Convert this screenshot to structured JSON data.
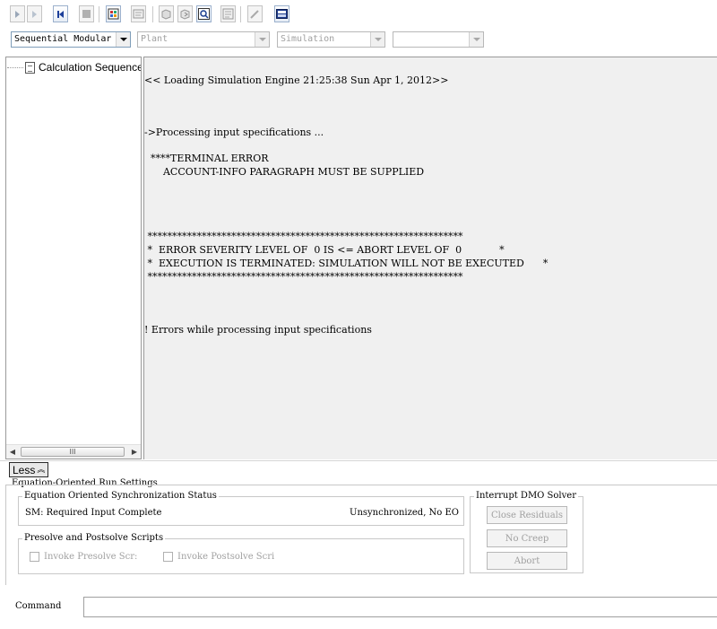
{
  "toolbar": {
    "buttons": [
      {
        "name": "next-button",
        "icon": "play-next-icon"
      },
      {
        "name": "run-button",
        "icon": "play-icon"
      },
      {
        "name": "reinitialize-button",
        "icon": "step-first-icon"
      },
      {
        "name": "stop-button",
        "icon": "stop-icon"
      },
      {
        "name": "control-panel-button",
        "icon": "control-panel-icon"
      },
      {
        "name": "results-button",
        "icon": "results-icon"
      },
      {
        "name": "check-status-button",
        "icon": "check-status-icon"
      },
      {
        "name": "export-button",
        "icon": "export-icon"
      },
      {
        "name": "view-report-button",
        "icon": "magnifier-icon"
      },
      {
        "name": "model-library-button",
        "icon": "model-library-icon"
      },
      {
        "name": "edit-button",
        "icon": "edit-icon"
      },
      {
        "name": "equation-oriented-button",
        "icon": "eo-icon"
      }
    ]
  },
  "combos": {
    "solution_strategy": {
      "value": "Sequential Modular"
    },
    "plant": {
      "value": "Plant"
    },
    "mode": {
      "value": "Simulation"
    },
    "extra": {
      "value": ""
    }
  },
  "tree": {
    "items": [
      {
        "label": "Calculation Sequence",
        "icon": "document-icon"
      }
    ],
    "scroll_thumb_label": "III",
    "scroll_left": "◀",
    "scroll_right": "▶"
  },
  "output": {
    "lines": [
      "<< Loading Simulation Engine 21:25:38 Sun Apr 1, 2012>>",
      "->Processing input specifications ...",
      "  ****TERMINAL ERROR",
      "      ACCOUNT-INFO PARAGRAPH MUST BE SUPPLIED",
      " ****************************************************************",
      " *  ERROR SEVERITY LEVEL OF  0 IS <= ABORT LEVEL OF  0            *",
      " *  EXECUTION IS TERMINATED: SIMULATION WILL NOT BE EXECUTED      *",
      " ****************************************************************",
      "! Errors while processing input specifications"
    ]
  },
  "less_button": {
    "label": "Less",
    "icon": "double-chevron-up-icon"
  },
  "eo_run_settings": {
    "title": "Equation-Oriented Run Settings",
    "sync_status": {
      "title": "Equation Oriented Synchronization Status",
      "left_text": "SM: Required Input Complete",
      "right_text": "Unsynchronized, No EO"
    },
    "scripts": {
      "title": "Presolve and Postsolve Scripts",
      "presolve_label": "Invoke Presolve Scr:",
      "postsolve_label": "Invoke Postsolve Scri"
    },
    "interrupt": {
      "title": "Interrupt DMO Solver",
      "close_residuals": "Close Residuals",
      "no_creep": "No Creep",
      "abort": "Abort"
    }
  },
  "command": {
    "label": "Command",
    "value": ""
  }
}
